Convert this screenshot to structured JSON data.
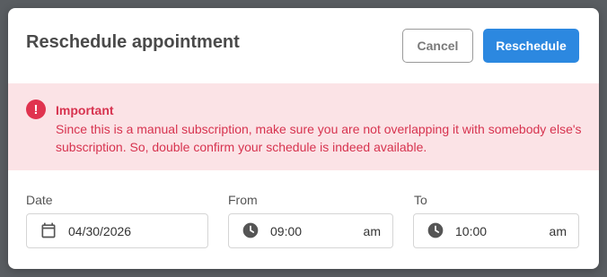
{
  "dialog": {
    "title": "Reschedule appointment",
    "cancel_label": "Cancel",
    "submit_label": "Reschedule"
  },
  "alert": {
    "icon": "exclamation-circle-icon",
    "icon_glyph": "!",
    "title": "Important",
    "message": "Since this is a manual subscription, make sure you are not overlapping it with somebody else's subscription. So, double confirm your schedule is indeed available."
  },
  "fields": {
    "date": {
      "label": "Date",
      "value": "04/30/2026",
      "icon": "calendar-icon"
    },
    "from": {
      "label": "From",
      "value": "09:00",
      "ampm": "am",
      "icon": "clock-icon"
    },
    "to": {
      "label": "To",
      "value": "10:00",
      "ampm": "am",
      "icon": "clock-icon"
    }
  },
  "colors": {
    "backdrop": "#595d61",
    "primary": "#2c88e0",
    "alert_bg": "#fbe3e6",
    "alert_text": "#d7334f"
  }
}
